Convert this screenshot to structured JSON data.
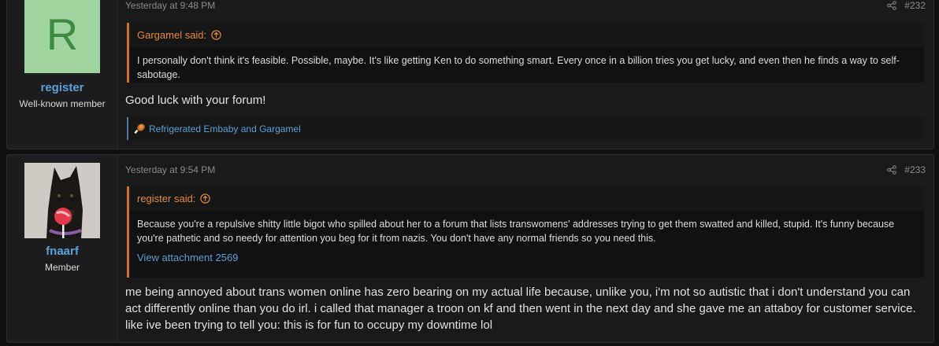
{
  "posts": [
    {
      "username": "register",
      "user_title": "Well-known member",
      "avatar_letter": "R",
      "date": "Yesterday at 9:48 PM",
      "post_number": "#232",
      "quote": {
        "author": "Gargamel said:",
        "text": "I personally don't think it's feasible. Possible, maybe. It's like getting Ken to do something smart. Every once in a billion tries you get lucky, and even then he finds a way to self-sabotage."
      },
      "body": "Good luck with your forum!",
      "reactions": "Refrigerated Embaby and Gargamel"
    },
    {
      "username": "fnaarf",
      "user_title": "Member",
      "date": "Yesterday at 9:54 PM",
      "post_number": "#233",
      "quote": {
        "author": "register said:",
        "text": "Because you're a repulsive shitty little bigot who spilled about her to a forum that lists transwomens' addresses trying to get them swatted and killed, stupid. It's funny because you're pathetic and so needy for attention you beg for it from nazis. You don't have any normal friends so you need this.",
        "attachment": "View attachment 2569"
      },
      "body": "me being annoyed about trans women online has zero bearing on my actual life because, unlike you, i'm not so autistic that i don't understand you can act differently online than you do irl. i called that manager a troon on kf and then went in the next day and she gave me an attaboy for customer service. like ive been trying to tell you: this is for fun to occupy my downtime lol"
    }
  ],
  "icons": {
    "share": "share-icon",
    "quote_up": "arrow-up-circle-icon",
    "reaction": "drumstick-icon"
  },
  "colors": {
    "accent": "#e4893a",
    "link": "#5a9fd6",
    "background": "#0f0f10"
  }
}
